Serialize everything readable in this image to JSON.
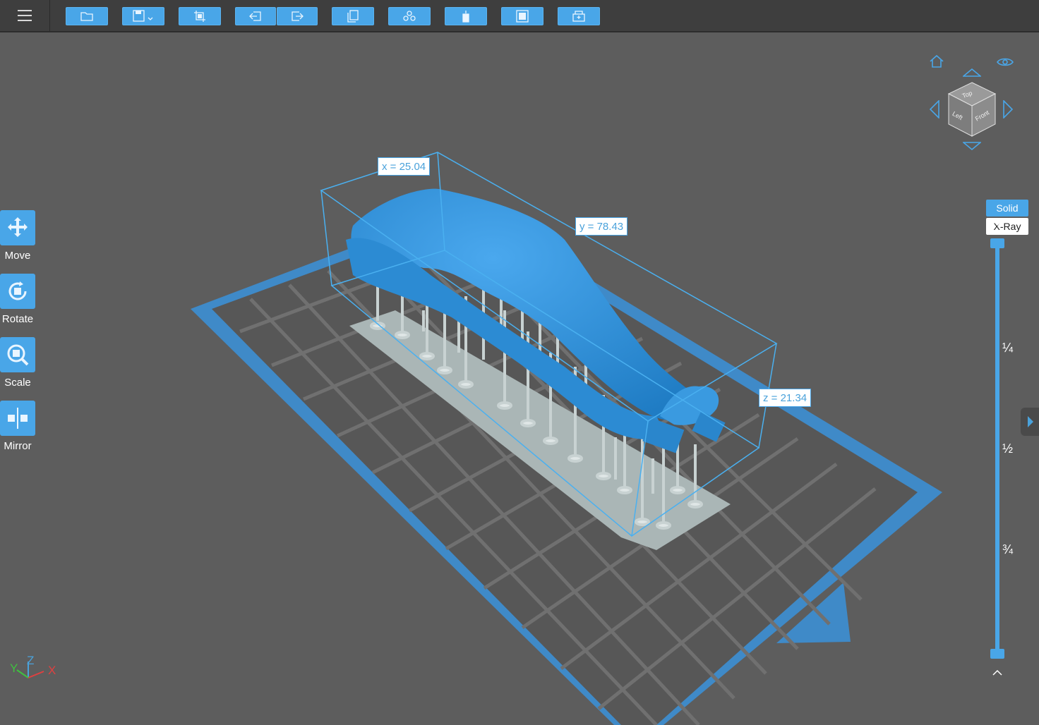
{
  "toolbar": {
    "buttons": [
      {
        "name": "open-file-button",
        "icon": "folder-icon"
      },
      {
        "name": "save-button",
        "icon": "save-icon"
      },
      {
        "name": "crop-button",
        "icon": "crop-icon"
      },
      {
        "name": "import-button",
        "icon": "arrow-left-icon"
      },
      {
        "name": "export-button",
        "icon": "arrow-right-icon"
      },
      {
        "name": "copy-button",
        "icon": "copy-icon"
      },
      {
        "name": "arrange-button",
        "icon": "objects-icon"
      },
      {
        "name": "support-button",
        "icon": "support-icon"
      },
      {
        "name": "slice-button",
        "icon": "square-icon"
      },
      {
        "name": "print-button",
        "icon": "printer-icon"
      }
    ]
  },
  "tools": [
    {
      "label": "Move",
      "icon": "move-icon"
    },
    {
      "label": "Rotate",
      "icon": "rotate-icon"
    },
    {
      "label": "Scale",
      "icon": "scale-icon"
    },
    {
      "label": "Mirror",
      "icon": "mirror-icon"
    }
  ],
  "dimensions": {
    "x": "x = 25.04",
    "y": "y = 78.43",
    "z": "z = 21.34"
  },
  "view_cube": {
    "top": "Top",
    "left": "Left",
    "front": "Front"
  },
  "render_mode": {
    "solid": "Solid",
    "xray": "X-Ray",
    "selected": "Solid"
  },
  "layer_slider": {
    "marks": [
      "¼",
      "½",
      "¾"
    ],
    "upper": 1.0,
    "lower": 0.0
  },
  "axes": {
    "x": "X",
    "y": "Y",
    "z": "Z"
  },
  "colors": {
    "accent": "#49a6e8",
    "model": "#2f8fd6",
    "supports": "#b9c4c4",
    "platform_border": "#3f8ac8",
    "background": "#5d5d5d"
  }
}
